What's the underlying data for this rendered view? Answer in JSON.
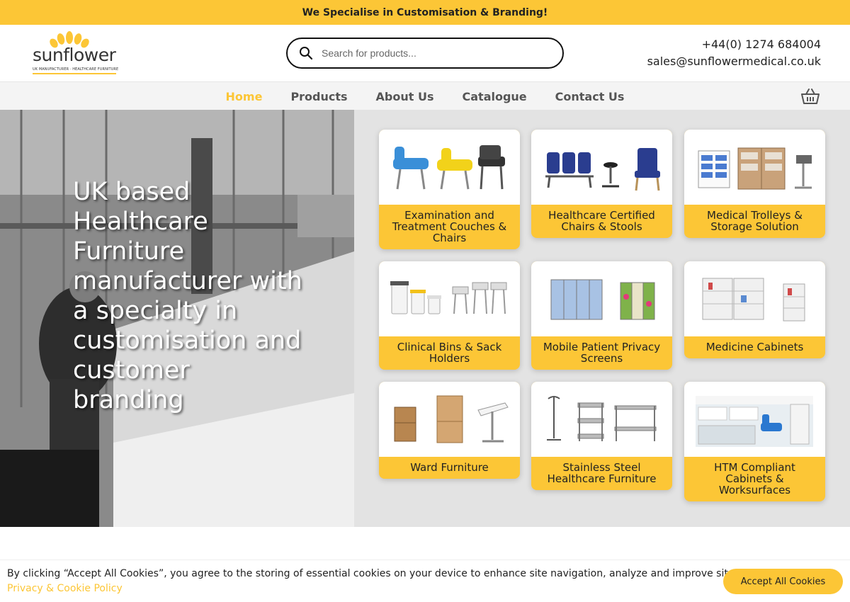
{
  "promo": {
    "text": "We Specialise in Customisation & Branding!"
  },
  "header": {
    "logo_word": "sunflower",
    "logo_tagline": "UK MANUFACTURER · HEALTHCARE FURNITURE",
    "search_placeholder": "Search for products...",
    "phone": "+44(0) 1274 684004",
    "email": "sales@sunflowermedical.co.uk"
  },
  "nav": {
    "items": [
      {
        "label": "Home",
        "active": true
      },
      {
        "label": "Products"
      },
      {
        "label": "About Us"
      },
      {
        "label": "Catalogue"
      },
      {
        "label": "Contact Us"
      }
    ],
    "icon": "basket-icon"
  },
  "hero": {
    "text": "UK based Healthcare Furniture manufacturer with a specialty in customisation and customer branding"
  },
  "products": [
    {
      "label": "Examination and Treatment Couches & Chairs"
    },
    {
      "label": "Healthcare Certified Chairs & Stools"
    },
    {
      "label": "Medical Trolleys & Storage Solution"
    },
    {
      "label": "Clinical Bins & Sack Holders"
    },
    {
      "label": "Mobile Patient Privacy Screens"
    },
    {
      "label": "Medicine Cabinets"
    },
    {
      "label": "Ward Furniture"
    },
    {
      "label": "Stainless Steel Healthcare Furniture"
    },
    {
      "label": "HTM Compliant Cabinets & Worksurfaces"
    }
  ],
  "cookie": {
    "message": "By clicking “Accept All Cookies”, you agree to the storing of essential cookies on your device to enhance site navigation, analyze and improve site usage.",
    "policy_link": "Privacy & Cookie Policy",
    "accept_label": "Accept All Cookies"
  },
  "colors": {
    "brand_yellow": "#fcc636",
    "text_dark": "#222222",
    "nav_bg": "#f4f4f4"
  }
}
